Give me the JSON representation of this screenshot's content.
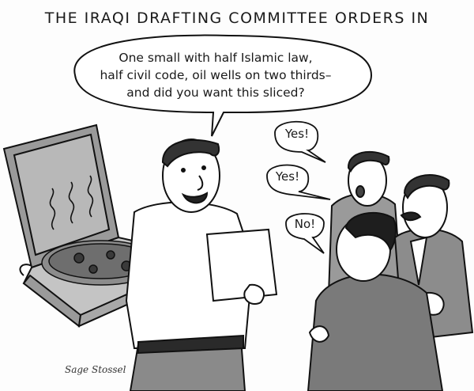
{
  "caption": "THE IRAQI DRAFTING COMMITTEE ORDERS IN",
  "speech": {
    "line1": "One small with half Islamic law,",
    "line2": "half civil code, oil wells on two thirds–",
    "line3": "and did you want this sliced?"
  },
  "replies": {
    "first": "Yes!",
    "second": "Yes!",
    "third": "No!"
  },
  "signature": "Sage Stossel"
}
